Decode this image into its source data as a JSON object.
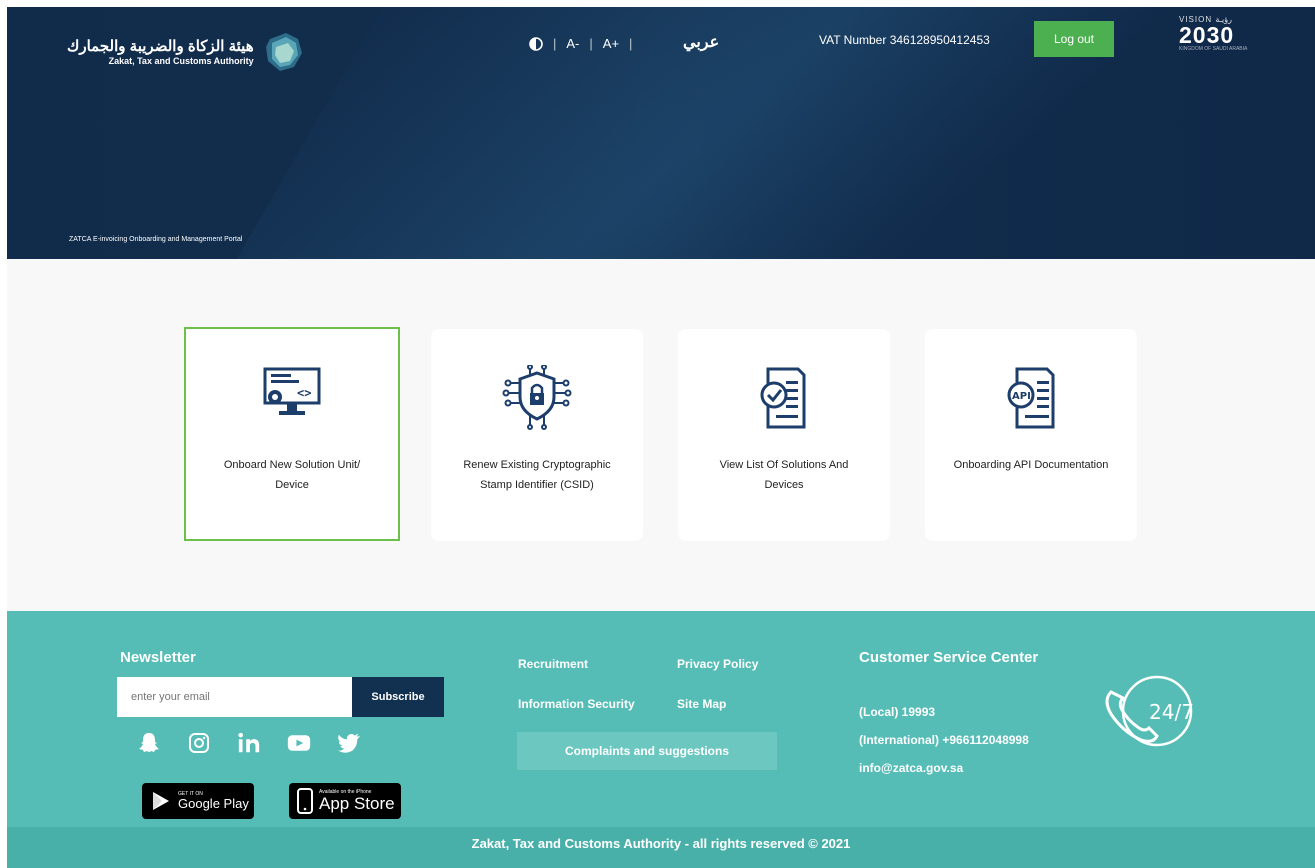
{
  "header": {
    "logo_ar": "هيئة الزكاة والضريبة والجمارك",
    "logo_en": "Zakat, Tax and Customs Authority",
    "contrast_icon": "contrast-icon",
    "font_decrease": "A-",
    "font_increase": "A+",
    "language_link": "عربي",
    "vat_label": "VAT Number 346128950412453",
    "logout_label": "Log out",
    "vision_top": "VISION رؤيـة",
    "vision_year": "2030",
    "vision_sub": "KINGDOM OF SAUDI ARABIA",
    "portal_title": "ZATCA E-invoicing Onboarding and Management Portal"
  },
  "cards": [
    {
      "label_line1": "Onboard New Solution Unit/",
      "label_line2": "Device",
      "icon": "monitor-code-icon",
      "selected": true
    },
    {
      "label_line1": "Renew Existing Cryptographic",
      "label_line2": "Stamp Identifier (CSID)",
      "icon": "shield-lock-circuit-icon",
      "selected": false
    },
    {
      "label_line1": "View List Of Solutions And",
      "label_line2": "Devices",
      "icon": "document-check-icon",
      "selected": false
    },
    {
      "label_line1": "Onboarding API Documentation",
      "label_line2": "",
      "icon": "api-document-icon",
      "selected": false
    }
  ],
  "footer": {
    "newsletter_title": "Newsletter",
    "email_placeholder": "enter your email",
    "subscribe_label": "Subscribe",
    "social": [
      "snapchat-icon",
      "instagram-icon",
      "linkedin-icon",
      "youtube-icon",
      "twitter-icon"
    ],
    "google_play_small": "GET IT ON",
    "google_play_big": "Google Play",
    "app_store_small": "Available on the iPhone",
    "app_store_big": "App Store",
    "links": {
      "recruitment": "Recruitment",
      "privacy": "Privacy Policy",
      "info_security": "Information Security",
      "site_map": "Site Map",
      "complaints": "Complaints and suggestions"
    },
    "csc_title": "Customer Service Center",
    "local": "(Local) 19993",
    "international": "(International) +966112048998",
    "email": "info@zatca.gov.sa",
    "support_badge": "24/7",
    "copyright": "Zakat, Tax and Customs Authority - all rights reserved © 2021"
  },
  "colors": {
    "header_bg": "#122d4e",
    "accent_green": "#4caf50",
    "footer_teal": "#55bdb6",
    "icon_navy": "#1d3d6b"
  }
}
